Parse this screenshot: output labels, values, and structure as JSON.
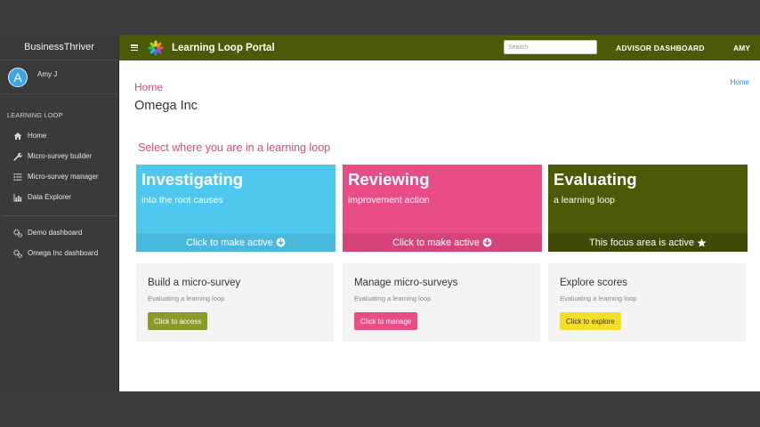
{
  "sidebar": {
    "brand": "BusinessThriver",
    "user": {
      "initial": "A",
      "name": "Amy J"
    },
    "section_label": "LEARNING LOOP",
    "items": [
      {
        "label": "Home",
        "icon": "home-icon"
      },
      {
        "label": "Micro-survey builder",
        "icon": "wrench-icon"
      },
      {
        "label": "Micro-survey manager",
        "icon": "list-icon"
      },
      {
        "label": "Data Explorer",
        "icon": "bar-chart-icon"
      }
    ],
    "dashboards": [
      {
        "label": "Demo dashboard",
        "icon": "gears-icon"
      },
      {
        "label": "Omega Inc dashboard",
        "icon": "gears-icon"
      }
    ]
  },
  "topbar": {
    "title": "Learning Loop Portal",
    "search_placeholder": "Search",
    "advisor_label": "ADVISOR DASHBOARD",
    "user_label": "AMY",
    "color": "#4a5a07"
  },
  "breadcrumb": {
    "page": "Home",
    "link": "Home"
  },
  "org_name": "Omega Inc",
  "prompt": "Select where you are in a learning loop",
  "stages": [
    {
      "title": "Investigating",
      "subtitle": "into the root causes",
      "footer": "Click to make active",
      "color": "#4fc8ef",
      "footer_color": "#48b8dc",
      "icon": "arrow-down-circle-icon"
    },
    {
      "title": "Reviewing",
      "subtitle": "improvement action",
      "footer": "Click to make active",
      "color": "#e94d86",
      "footer_color": "#d5447a",
      "icon": "arrow-down-circle-icon"
    },
    {
      "title": "Evaluating",
      "subtitle": "a learning loop",
      "footer": "This focus area is active",
      "color": "#4a5a07",
      "footer_color": "#3e4b06",
      "icon": "star-icon"
    }
  ],
  "panels": [
    {
      "title": "Build a micro-survey",
      "subtitle": "Evaluating a learning loop",
      "button": "Click to access",
      "button_color": "#8b9a2b",
      "button_text_color": "#ffffff"
    },
    {
      "title": "Manage micro-surveys",
      "subtitle": "Evaluating a learning loop",
      "button": "Click to manage",
      "button_color": "#e94d86",
      "button_text_color": "#ffffff"
    },
    {
      "title": "Explore scores",
      "subtitle": "Evaluating a learning loop",
      "button": "Click to explore",
      "button_color": "#f5dd2c",
      "button_text_color": "#333333"
    }
  ]
}
